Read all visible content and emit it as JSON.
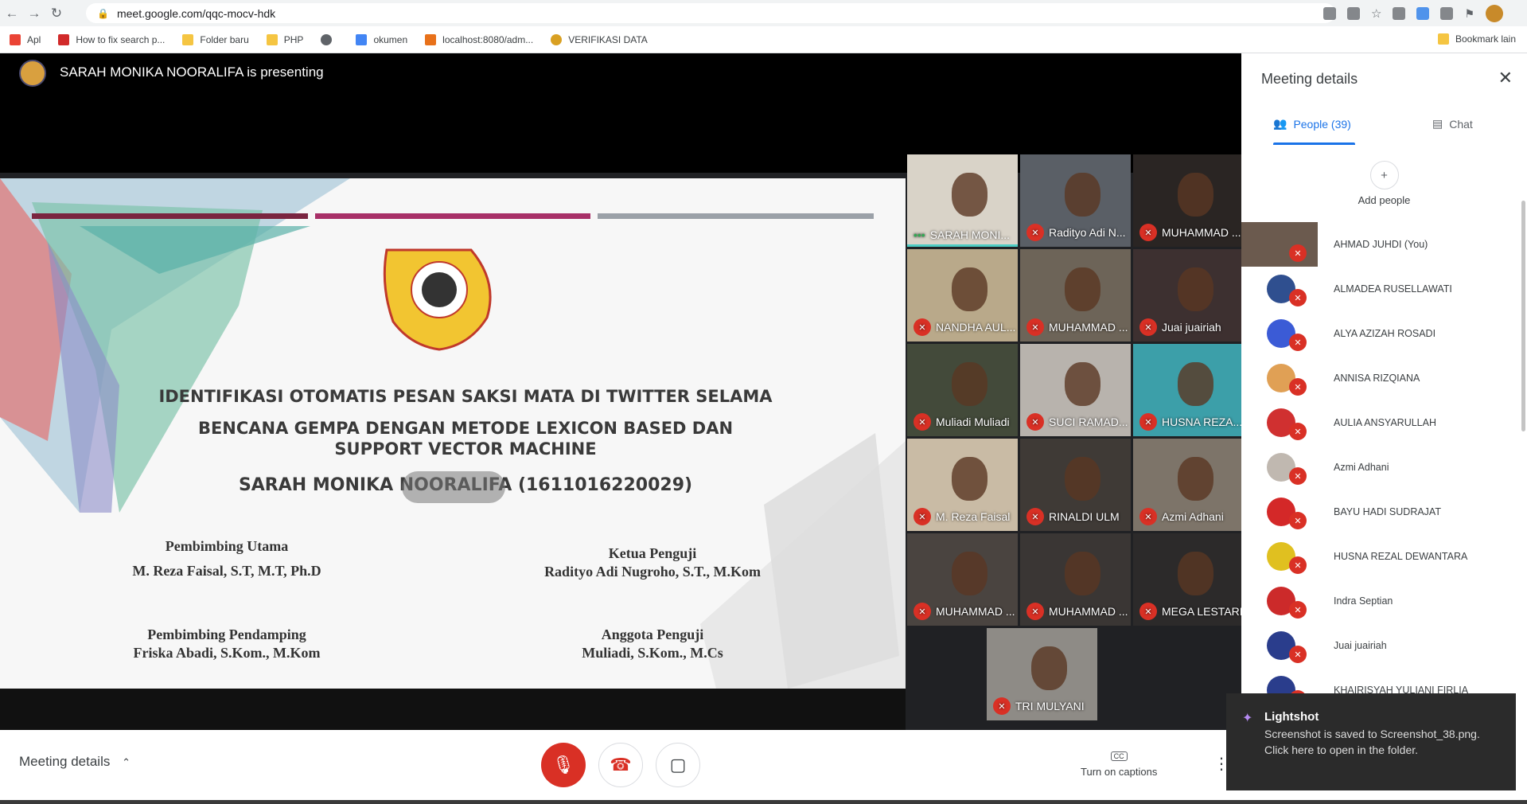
{
  "browser": {
    "url": "meet.google.com/qqc-mocv-hdk",
    "bookmarks": [
      "Apl",
      "How to fix search p...",
      "Folder baru",
      "PHP",
      "okumen",
      "localhost:8080/adm...",
      "VERIFIKASI DATA"
    ],
    "bookmark_other": "Bookmark lain"
  },
  "meet": {
    "presenter_text": "SARAH MONIKA NOORALIFA is presenting",
    "slide": {
      "title_line1": "IDENTIFIKASI OTOMATIS PESAN SAKSI MATA DI TWITTER SELAMA",
      "title_line2": "BENCANA GEMPA DENGAN METODE LEXICON BASED DAN",
      "title_line3": "SUPPORT VECTOR MACHINE",
      "author": "SARAH MONIKA NOORALIFA (1611016220029)",
      "pembimbing_utama_label": "Pembimbing Utama",
      "pembimbing_utama": "M. Reza Faisal, S.T, M.T, Ph.D",
      "ketua_penguji_label": "Ketua Penguji",
      "ketua_penguji": "Radityo Adi Nugroho, S.T., M.Kom",
      "pembimbing_pendamping_label": "Pembimbing Pendamping",
      "pembimbing_pendamping": "Friska Abadi, S.Kom., M.Kom",
      "anggota_penguji_label": "Anggota Penguji",
      "anggota_penguji": "Muliadi, S.Kom., M.Cs"
    },
    "tiles": [
      {
        "name": "SARAH MONI...",
        "speaking": true,
        "bg": "#d9d3c8"
      },
      {
        "name": "Radityo Adi N...",
        "bg": "#5a5f66"
      },
      {
        "name": "MUHAMMAD ...",
        "bg": "#2a2523"
      },
      {
        "name": "NANDHA AUL...",
        "bg": "#b9a98a"
      },
      {
        "name": "MUHAMMAD ...",
        "bg": "#6d6458"
      },
      {
        "name": "Juai juairiah",
        "bg": "#3d3030"
      },
      {
        "name": "Muliadi Muliadi",
        "bg": "#434a3a"
      },
      {
        "name": "SUCI RAMAD...",
        "bg": "#b8b3ad"
      },
      {
        "name": "HUSNA REZA...",
        "bg": "#3c9fa9"
      },
      {
        "name": "M. Reza Faisal",
        "bg": "#c9bba5"
      },
      {
        "name": "RINALDI ULM",
        "bg": "#3f3a36"
      },
      {
        "name": "Azmi Adhani",
        "bg": "#7d7469"
      },
      {
        "name": "MUHAMMAD ...",
        "bg": "#4a4440"
      },
      {
        "name": "MUHAMMAD ...",
        "bg": "#3a3634"
      },
      {
        "name": "MEGA LESTARI",
        "bg": "#2c2a2a"
      },
      {
        "name": "TRI MULYANI",
        "bg": "#8e8b86"
      }
    ],
    "bottom": {
      "meeting_details": "Meeting details",
      "captions": "Turn on captions"
    }
  },
  "panel": {
    "title": "Meeting details",
    "people_tab": "People (39)",
    "chat_tab": "Chat",
    "add_people": "Add people",
    "people": [
      {
        "name": "AHMAD JUHDI (You)",
        "color": "#6b5a4e"
      },
      {
        "name": "ALMADEA RUSELLAWATI",
        "color": "#2f4f8f"
      },
      {
        "name": "ALYA AZIZAH ROSADI",
        "color": "#3b5bd6"
      },
      {
        "name": "ANNISA RIZQIANA",
        "color": "#e0a055"
      },
      {
        "name": "AULIA ANSYARULLAH",
        "color": "#d03030"
      },
      {
        "name": "Azmi Adhani",
        "color": "#c0b8b0"
      },
      {
        "name": "BAYU HADI SUDRAJAT",
        "color": "#d42828"
      },
      {
        "name": "HUSNA REZAL DEWANTARA",
        "color": "#e0c020"
      },
      {
        "name": "Indra Septian",
        "color": "#cc2a2a"
      },
      {
        "name": "Juai juairiah",
        "color": "#2a3d8c"
      },
      {
        "name": "KHAIRISYAH YULIANI FIRLIA",
        "color": "#2a3d8c"
      }
    ]
  },
  "toast": {
    "title": "Lightshot",
    "body": "Screenshot is saved to Screenshot_38.png. Click here to open in the folder."
  }
}
